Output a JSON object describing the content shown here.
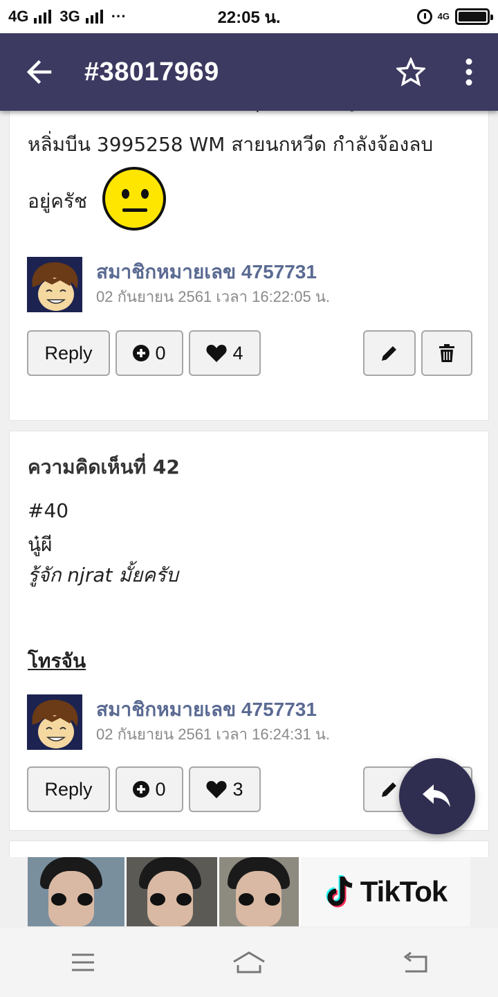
{
  "status_bar": {
    "network_left": "4G",
    "network_mid": "3G",
    "more": "···",
    "time": "22:05 น.",
    "network_right": "4G"
  },
  "app_bar": {
    "title": "#38017969",
    "icons": [
      "back-arrow-icon",
      "star-icon",
      "more-vert-icon"
    ]
  },
  "comments": [
    {
      "cut_text": "เพื่อนๆผ่ายบรรจายบ เดยทุกท่าน เชิญครับ !!!",
      "body_lines": [
        "หลิ่มบีน 3995258 WM สายนกหวีด กำลังจ้องลบ",
        "อยู่ครัช"
      ],
      "emoji": "neutral-face",
      "author_name": "สมาชิกหมายเลข 4757731",
      "date": "02 กันยายน 2561 เวลา 16:22:05 น.",
      "reply_label": "Reply",
      "plus_count": "0",
      "like_count": "4"
    },
    {
      "heading": "ความคิดเห็นที่ 42",
      "quote_ref": "#40",
      "quote_name": "นู๋ผี",
      "quote_text": "รู้จัก njrat มั้ยครับ",
      "link_text": "โทรจัน",
      "author_name": "สมาชิกหมายเลข 4757731",
      "date": "02 กันยายน 2561 เวลา 16:24:31 น.",
      "reply_label": "Reply",
      "plus_count": "0",
      "like_count": "3"
    }
  ],
  "ad": {
    "brand": "TikTok"
  },
  "colors": {
    "app_bar": "#3c3a60",
    "fab": "#302e50",
    "author_name": "#5a6a92"
  },
  "nav_bar": {
    "icons": [
      "menu-icon",
      "home-icon",
      "back-icon"
    ]
  }
}
